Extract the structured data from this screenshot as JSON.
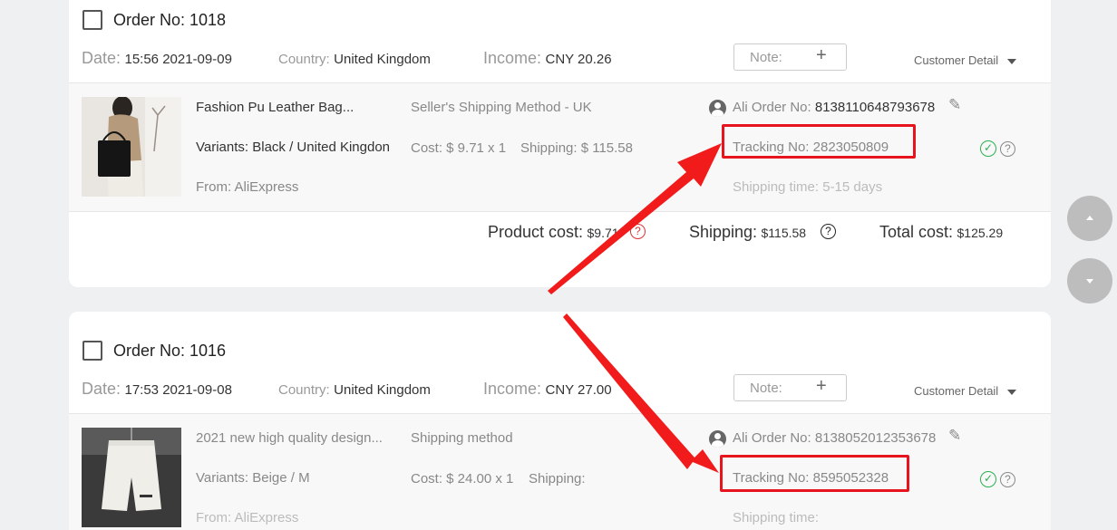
{
  "orders": [
    {
      "title": "Order No: 1018",
      "date_label": "Date:",
      "date": "15:56 2021-09-09",
      "country_label": "Country:",
      "country": "United Kingdom",
      "income_label": "Income:",
      "income": "CNY 20.26",
      "note_label": "Note:",
      "note_plus": "+",
      "customer_detail": "Customer Detail",
      "product_name": "Fashion Pu Leather Bag...",
      "variants": "Variants: Black / United Kingdon",
      "from": "From: AliExpress",
      "shipping_method": "Seller's Shipping Method - UK",
      "cost": "Cost: $ 9.71 x 1",
      "shipping": "Shipping: $ 115.58",
      "ali_label": "Ali Order No:",
      "ali_no": "8138110648793678",
      "tracking": "Tracking No: 2823050809",
      "shipping_time": "Shipping time: 5-15 days",
      "product_cost_label": "Product cost:",
      "product_cost": "$9.71",
      "shipping_total_label": "Shipping:",
      "shipping_total": "$115.58",
      "total_label": "Total cost:",
      "total": "$125.29"
    },
    {
      "title": "Order No: 1016",
      "date_label": "Date:",
      "date": "17:53 2021-09-08",
      "country_label": "Country:",
      "country": "United Kingdom",
      "income_label": "Income:",
      "income": "CNY 27.00",
      "note_label": "Note:",
      "note_plus": "+",
      "customer_detail": "Customer Detail",
      "product_name": "2021 new high quality design...",
      "variants": "Variants: Beige / M",
      "from": "From: AliExpress",
      "shipping_method": "Shipping method",
      "cost": "Cost: $ 24.00 x 1",
      "shipping": "Shipping:",
      "ali_label": "Ali Order No:",
      "ali_no": "8138052012353678",
      "tracking": "Tracking No: 8595052328",
      "shipping_time": "Shipping time:"
    }
  ],
  "icons": {
    "check": "✓",
    "question": "?",
    "edit": "✎"
  },
  "colors": {
    "highlight": "#e8141d",
    "ok": "#2ab14e"
  }
}
